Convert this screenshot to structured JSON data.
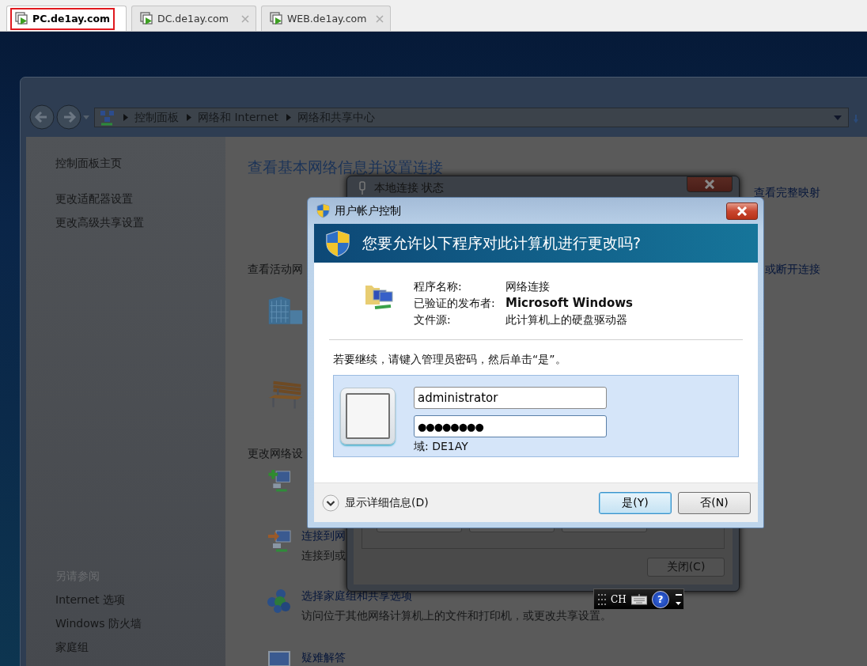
{
  "tabs": [
    {
      "label": "PC.de1ay.com",
      "selected": true
    },
    {
      "label": "DC.de1ay.com",
      "selected": false
    },
    {
      "label": "WEB.de1ay.com",
      "selected": false
    }
  ],
  "explorer": {
    "breadcrumb": [
      "控制面板",
      "网络和 Internet",
      "网络和共享中心"
    ],
    "sidebar": {
      "links": [
        "控制面板主页",
        "更改适配器设置",
        "更改高级共享设置"
      ],
      "see_also_title": "另请参阅",
      "see_also": [
        "Internet 选项",
        "Windows 防火墙",
        "家庭组"
      ]
    },
    "main": {
      "heading": "查看基本网络信息并设置连接",
      "map_link": "查看完整映射",
      "active_networks_label": "查看活动网",
      "connect_link": "或断开连接",
      "change_settings_label": "更改网络设",
      "tasks": [
        {
          "kind": "connect",
          "title": "连接到网",
          "description": "连接到或"
        },
        {
          "kind": "homegroup",
          "title": "选择家庭组和共享选项",
          "description": "访问位于其他网络计算机上的文件和打印机，或更改共享设置。"
        },
        {
          "kind": "troubleshoot",
          "title": "疑难解答"
        }
      ]
    }
  },
  "status_dialog": {
    "title": "本地连接 状态",
    "close_button": "关闭(C)"
  },
  "uac": {
    "title": "用户帐户控制",
    "question": "您要允许以下程序对此计算机进行更改吗?",
    "details": [
      {
        "label": "程序名称:",
        "value": "网络连接",
        "emphasis": false
      },
      {
        "label": "已验证的发布者:",
        "value": "Microsoft Windows",
        "emphasis": true
      },
      {
        "label": "文件源:",
        "value": "此计算机上的硬盘驱动器",
        "emphasis": false
      }
    ],
    "instruction": "若要继续，请键入管理员密码，然后单击“是”。",
    "username": "administrator",
    "password": "●●●●●●●●",
    "domain": "域: DE1AY",
    "details_toggle": "显示详细信息(D)",
    "buttons": [
      {
        "label": "是(Y)",
        "default": true
      },
      {
        "label": "否(N)",
        "default": false
      }
    ]
  },
  "language_bar": {
    "language": "CH",
    "help": "?"
  }
}
